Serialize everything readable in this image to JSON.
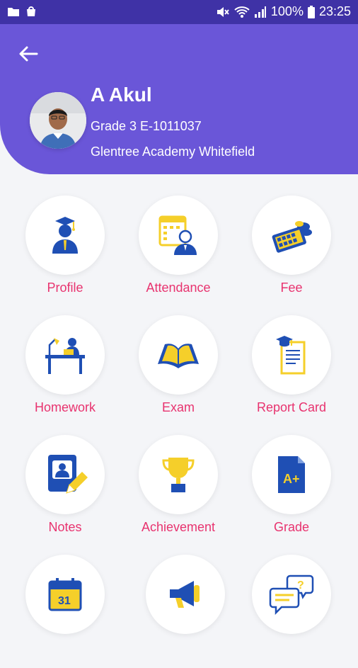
{
  "status_bar": {
    "battery": "100%",
    "time": "23:25"
  },
  "header": {
    "name": "A Akul",
    "grade_line": "Grade 3 E-1011037",
    "school": "Glentree Academy Whitefield"
  },
  "menu": [
    {
      "label": "Profile",
      "icon": "graduate-icon"
    },
    {
      "label": "Attendance",
      "icon": "attendance-icon"
    },
    {
      "label": "Fee",
      "icon": "fee-calculator-icon"
    },
    {
      "label": "Homework",
      "icon": "homework-desk-icon"
    },
    {
      "label": "Exam",
      "icon": "open-book-icon"
    },
    {
      "label": "Report Card",
      "icon": "report-card-icon"
    },
    {
      "label": "Notes",
      "icon": "notes-icon"
    },
    {
      "label": "Achievement",
      "icon": "trophy-icon"
    },
    {
      "label": "Grade",
      "icon": "grade-document-icon"
    },
    {
      "label": "",
      "icon": "calendar-icon"
    },
    {
      "label": "",
      "icon": "megaphone-icon"
    },
    {
      "label": "",
      "icon": "chat-question-icon"
    }
  ],
  "calendar": {
    "day": "31"
  },
  "grade_icon": {
    "text": "A+"
  },
  "colors": {
    "header": "#6a56d8",
    "status_bar": "#3f32a6",
    "label": "#e8336f",
    "icon_blue": "#1f4fb4",
    "icon_yellow": "#f5cf2a"
  }
}
